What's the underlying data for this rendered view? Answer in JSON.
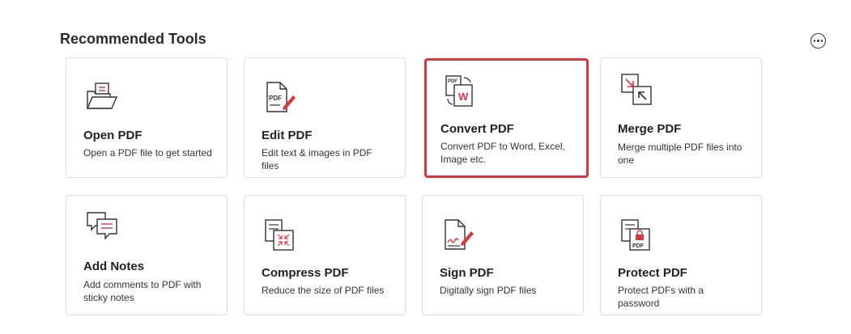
{
  "section": {
    "title": "Recommended Tools",
    "more_icon": "more-options-icon"
  },
  "colors": {
    "accent": "#d9363e",
    "border": "#dedede",
    "icon": "#333333"
  },
  "tools": [
    {
      "title": "Open PDF",
      "description": "Open a PDF file to get started",
      "icon": "open-folder-icon",
      "selected": false
    },
    {
      "title": "Edit PDF",
      "description": "Edit text & images in PDF files",
      "icon": "edit-pdf-icon",
      "selected": false
    },
    {
      "title": "Convert PDF",
      "description": "Convert PDF to Word, Excel, Image etc.",
      "icon": "convert-pdf-icon",
      "selected": true
    },
    {
      "title": "Merge PDF",
      "description": "Merge multiple PDF files into one",
      "icon": "merge-pdf-icon",
      "selected": false
    },
    {
      "title": "Add Notes",
      "description": "Add comments to PDF with sticky notes",
      "icon": "notes-icon",
      "selected": false
    },
    {
      "title": "Compress PDF",
      "description": "Reduce the size of PDF files",
      "icon": "compress-pdf-icon",
      "selected": false
    },
    {
      "title": "Sign PDF",
      "description": "Digitally sign PDF files",
      "icon": "sign-pdf-icon",
      "selected": false
    },
    {
      "title": "Protect PDF",
      "description": "Protect PDFs with a password",
      "icon": "protect-pdf-icon",
      "selected": false
    }
  ]
}
